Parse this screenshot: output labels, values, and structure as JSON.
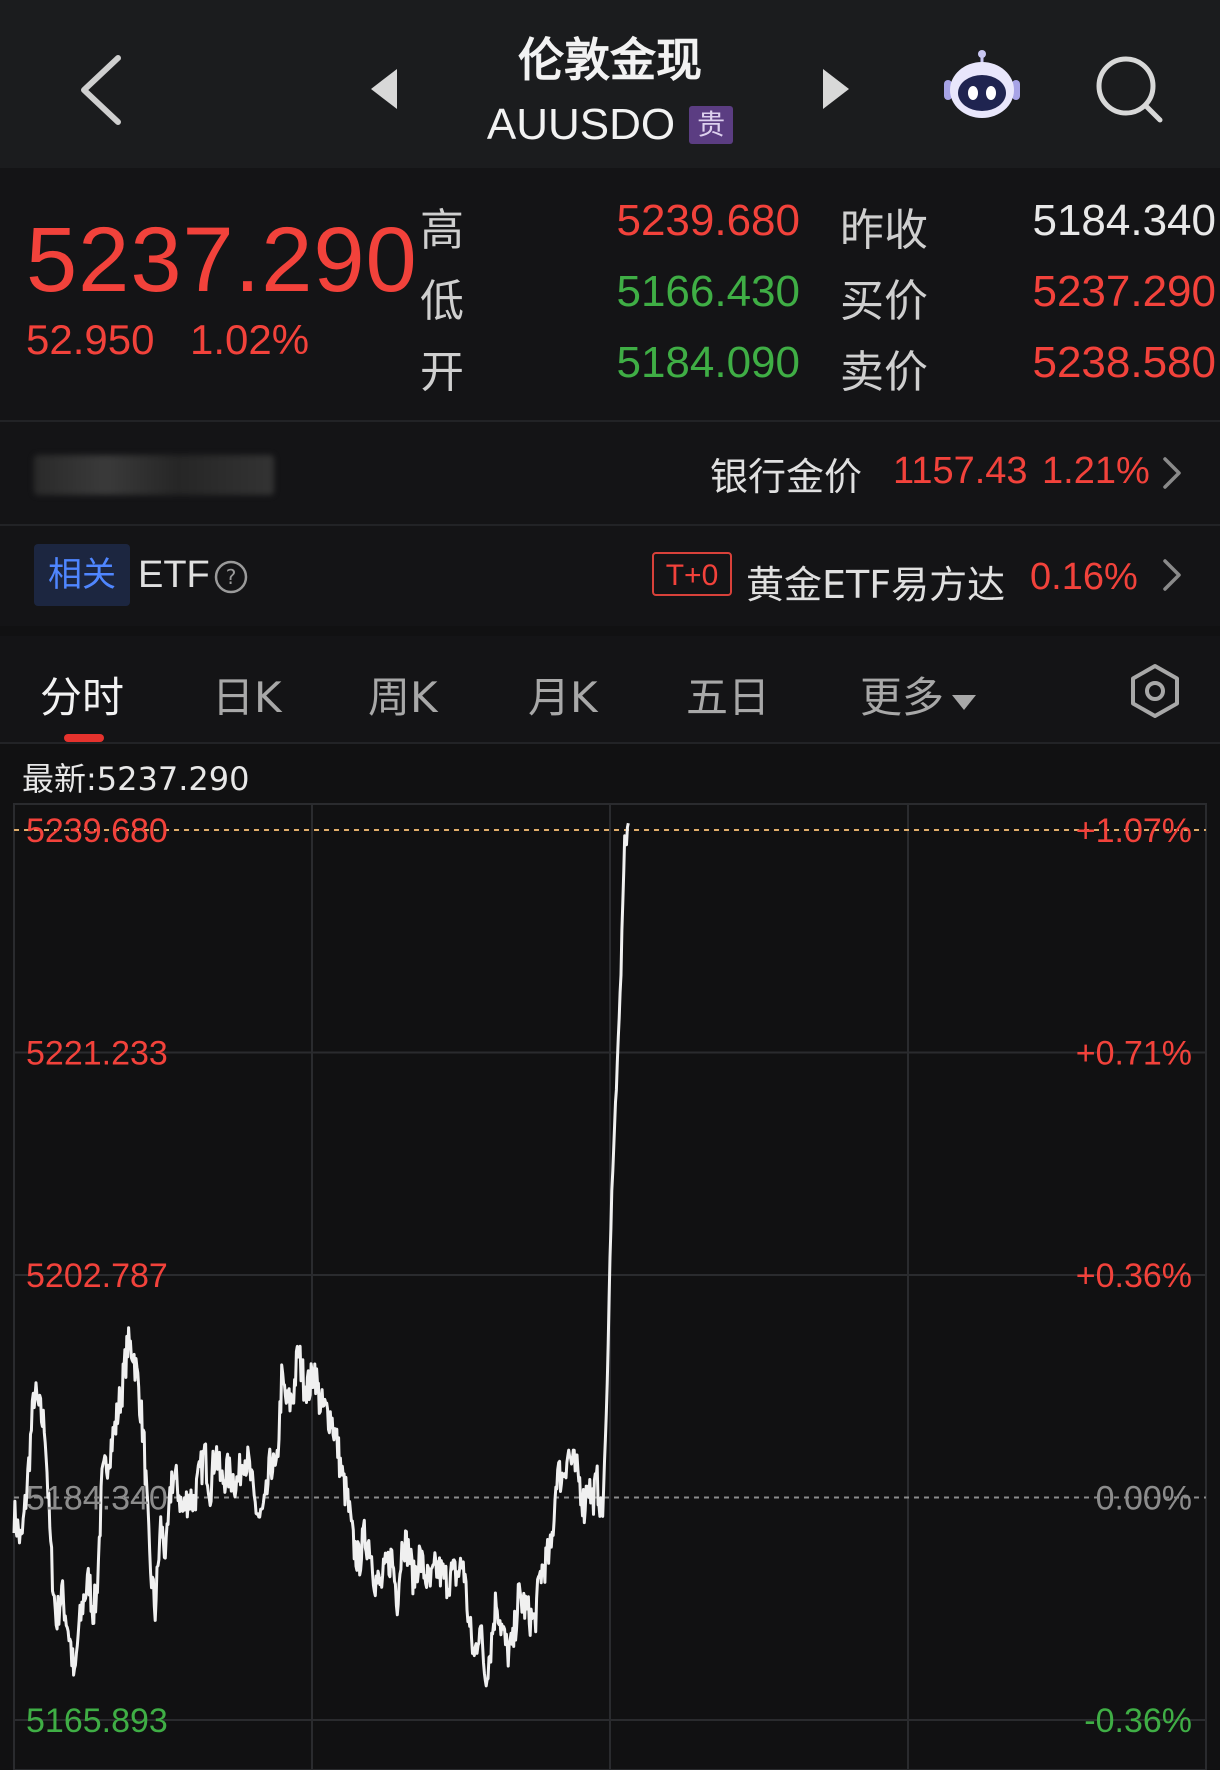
{
  "header": {
    "title": "伦敦金现",
    "symbol": "AUUSDO",
    "tag": "贵",
    "icons": {
      "back": "chevron-left-icon",
      "prev": "triangle-left-icon",
      "next": "triangle-right-icon",
      "assistant": "robot-icon",
      "search": "search-icon"
    }
  },
  "quote": {
    "price": "5237.290",
    "change": "52.950",
    "change_pct": "1.02%",
    "high_label": "高",
    "high": "5239.680",
    "low_label": "低",
    "low": "5166.430",
    "open_label": "开",
    "open": "5184.090",
    "prev_close_label": "昨收",
    "prev_close": "5184.340",
    "bid_label": "买价",
    "bid": "5237.290",
    "ask_label": "卖价",
    "ask": "5238.580",
    "colors": {
      "up": "#f2423b",
      "down": "#3fae45"
    }
  },
  "bank": {
    "label": "银行金价",
    "price": "1157.43",
    "pct": "1.21%"
  },
  "etf": {
    "related": "相关",
    "label": "ETF",
    "t0": "T+0",
    "name": "黄金ETF易方达",
    "pct": "0.16%"
  },
  "tabs": [
    {
      "label": "分时",
      "active": true
    },
    {
      "label": "日K"
    },
    {
      "label": "周K"
    },
    {
      "label": "月K"
    },
    {
      "label": "五日"
    },
    {
      "label": "更多"
    }
  ],
  "chart_data": {
    "type": "line",
    "latest_label": "最新:5237.290",
    "prev_close": 5184.34,
    "y_ticks": [
      "5239.680",
      "5221.233",
      "5202.787",
      "5184.340",
      "5165.893"
    ],
    "pct_ticks": [
      "+1.07%",
      "+0.71%",
      "+0.36%",
      "0.00%",
      "-0.36%"
    ],
    "ylim": [
      5165.893,
      5239.68
    ],
    "x": [
      0,
      2,
      4,
      6,
      8,
      10,
      12,
      14,
      16,
      18,
      20,
      22,
      24,
      26,
      28,
      30,
      32,
      34,
      36,
      38,
      40,
      42,
      44,
      46,
      48,
      50,
      52,
      54,
      56,
      58,
      60,
      62,
      64,
      66,
      68,
      70,
      72,
      74,
      76,
      78,
      80,
      82,
      84,
      86,
      88,
      90,
      92,
      94,
      96,
      98,
      100,
      102,
      104,
      106,
      108,
      110,
      112,
      114,
      116,
      118,
      120,
      122,
      124,
      126,
      128,
      130,
      132,
      134,
      136,
      138,
      140,
      142,
      144,
      146,
      148,
      150,
      152,
      154,
      156,
      158,
      160,
      162,
      164,
      166,
      168,
      170,
      172,
      174,
      176,
      178,
      180,
      182,
      184,
      186,
      188,
      190,
      192,
      194,
      196,
      198,
      200,
      202,
      204,
      206,
      208,
      210,
      212,
      214,
      216,
      218,
      220,
      222,
      224,
      226,
      228,
      230,
      232,
      234,
      236,
      238,
      240,
      242,
      244,
      246,
      248,
      250,
      252,
      254,
      256,
      258,
      260,
      262,
      264,
      266,
      268,
      270,
      272,
      274,
      276,
      278,
      280,
      282,
      284,
      286,
      288,
      290,
      292,
      294,
      296,
      298,
      300,
      302,
      304,
      306,
      308,
      310,
      312,
      314,
      316,
      318,
      320,
      322,
      324,
      326,
      328,
      330,
      332,
      334,
      336,
      338,
      340,
      342,
      344,
      346,
      348,
      350,
      352,
      354,
      356,
      358,
      360,
      362,
      364,
      366,
      368,
      370,
      372,
      374,
      376,
      378,
      380,
      382,
      384,
      386,
      388,
      390,
      392,
      394,
      396,
      398,
      400,
      402,
      404,
      406,
      408,
      410,
      412,
      414,
      416,
      418,
      420,
      422,
      424,
      426,
      428,
      430,
      432,
      434,
      436,
      438,
      440,
      442,
      444,
      446,
      448,
      450,
      452,
      454,
      456,
      458,
      460,
      462,
      464,
      466,
      468,
      470,
      472,
      474,
      476,
      478,
      480,
      482,
      484,
      486,
      488,
      490,
      492,
      494,
      496,
      498,
      500,
      502,
      504,
      506,
      508,
      510,
      512,
      514,
      516,
      518,
      520,
      522,
      524,
      526,
      528,
      530,
      532,
      534,
      536,
      538,
      540,
      542,
      544,
      546,
      548,
      550,
      552,
      554,
      556,
      558,
      560,
      562,
      564,
      566,
      568,
      570,
      572,
      574,
      576,
      578,
      580,
      582,
      584,
      586,
      588,
      590,
      592,
      594,
      596,
      598,
      600,
      602,
      604,
      606,
      608,
      610,
      612,
      614,
      616,
      618,
      620,
      622,
      624,
      626,
      628,
      630,
      632,
      634,
      636,
      638,
      640,
      642,
      644,
      646,
      648,
      650,
      652,
      654,
      656,
      658,
      660,
      662,
      664,
      666,
      668,
      670,
      672,
      674,
      676,
      678,
      680,
      682,
      684,
      686,
      688,
      690,
      692,
      694,
      696,
      698,
      700,
      702,
      704,
      706,
      708,
      710,
      712,
      714,
      716,
      718,
      720,
      722,
      724,
      726,
      728,
      730,
      732,
      734,
      736,
      738,
      740,
      742,
      744,
      746,
      748,
      750,
      752,
      754,
      756,
      758,
      760,
      762,
      764,
      766,
      768,
      770,
      772,
      774,
      776,
      778,
      780,
      782,
      784,
      786,
      788,
      790,
      792,
      794,
      796,
      798,
      800,
      802,
      804,
      806,
      808,
      810,
      812,
      814,
      816,
      818,
      820,
      822,
      824,
      826,
      828,
      830,
      832,
      834,
      836,
      838,
      840,
      842,
      844,
      846,
      848,
      850,
      852,
      854,
      856,
      858,
      860,
      862,
      864,
      866,
      868,
      870,
      872,
      874,
      876,
      878,
      880,
      882,
      884,
      886,
      888,
      890,
      892,
      894,
      896,
      898,
      900,
      902,
      904,
      906,
      908,
      910,
      912,
      914,
      916,
      918,
      920,
      922,
      924,
      926,
      928,
      930,
      932,
      934,
      936,
      938,
      940,
      942,
      944,
      946,
      948,
      950,
      952,
      954,
      956,
      958,
      960,
      962,
      964,
      966,
      968,
      970,
      972,
      974,
      976,
      978,
      980,
      982,
      984,
      986,
      988,
      990,
      992,
      994,
      996,
      998,
      1000,
      1002,
      1004,
      1006,
      1008,
      1010,
      1012,
      1014,
      1016,
      1018,
      1020,
      1022,
      1024,
      1026,
      1028,
      1030,
      1032,
      1034,
      1036,
      1038,
      1040,
      1042,
      1044,
      1046,
      1048,
      1050,
      1052,
      1054,
      1056,
      1058,
      1060,
      1062,
      1064,
      1066,
      1068,
      1070,
      1072,
      1074,
      1076,
      1078,
      1080,
      1082,
      1084,
      1086,
      1088,
      1090,
      1092,
      1094,
      1096,
      1098,
      1100,
      1102,
      1104,
      1106,
      1108,
      1110,
      1112,
      1114,
      1116,
      1118,
      1120,
      1122,
      1124,
      1126,
      1128,
      1130,
      1132,
      1134,
      1136,
      1138,
      1140,
      1142,
      1144,
      1146,
      1148,
      1150,
      1152,
      1154,
      1156,
      1158,
      1160,
      1162,
      1164,
      1166,
      1168,
      1170,
      1172,
      1174,
      1176,
      1178,
      1180,
      1182,
      1184,
      1186,
      1188,
      1190,
      1192,
      1194,
      1196,
      1198,
      1200,
      1202,
      1204,
      1206,
      1208,
      1210,
      1212,
      1214,
      1216,
      1218,
      1220,
      1222,
      1224,
      1226,
      1228,
      1230,
      1232,
      1234,
      1236,
      1238,
      1240,
      1242,
      1244,
      1246,
      1248,
      1250,
      1252,
      1254,
      1256,
      1258,
      1260,
      1262,
      1264,
      1266,
      1268,
      1270,
      1272,
      1274,
      1276,
      1278,
      1280,
      1282,
      1284,
      1286,
      1288,
      1290,
      1292,
      1294,
      1296,
      1298,
      1300
    ],
    "anchors": [
      [
        0,
        5183.0
      ],
      [
        8,
        5180.5
      ],
      [
        14,
        5185.0
      ],
      [
        22,
        5193.0
      ],
      [
        28,
        5191.5
      ],
      [
        34,
        5190.0
      ],
      [
        40,
        5180.0
      ],
      [
        46,
        5174.0
      ],
      [
        52,
        5176.5
      ],
      [
        58,
        5174.0
      ],
      [
        62,
        5172.0
      ],
      [
        66,
        5169.0
      ],
      [
        70,
        5173.0
      ],
      [
        76,
        5176.0
      ],
      [
        82,
        5177.5
      ],
      [
        86,
        5175.0
      ],
      [
        90,
        5176.0
      ],
      [
        96,
        5185.5
      ],
      [
        102,
        5187.5
      ],
      [
        110,
        5190.0
      ],
      [
        118,
        5193.5
      ],
      [
        124,
        5197.0
      ],
      [
        130,
        5196.5
      ],
      [
        136,
        5193.5
      ],
      [
        142,
        5188.5
      ],
      [
        148,
        5179.0
      ],
      [
        154,
        5175.0
      ],
      [
        160,
        5182.0
      ],
      [
        166,
        5179.5
      ],
      [
        172,
        5186.0
      ],
      [
        178,
        5185.5
      ],
      [
        184,
        5183.0
      ],
      [
        190,
        5184.5
      ],
      [
        196,
        5184.0
      ],
      [
        202,
        5186.0
      ],
      [
        208,
        5188.0
      ],
      [
        214,
        5185.0
      ],
      [
        220,
        5188.5
      ],
      [
        226,
        5185.5
      ],
      [
        232,
        5186.5
      ],
      [
        238,
        5186.0
      ],
      [
        244,
        5185.5
      ],
      [
        250,
        5188.0
      ],
      [
        256,
        5187.0
      ],
      [
        262,
        5184.0
      ],
      [
        268,
        5182.5
      ],
      [
        274,
        5183.5
      ],
      [
        280,
        5187.5
      ],
      [
        286,
        5186.0
      ],
      [
        292,
        5194.0
      ],
      [
        298,
        5192.0
      ],
      [
        304,
        5192.5
      ],
      [
        310,
        5196.5
      ],
      [
        316,
        5194.0
      ],
      [
        322,
        5193.5
      ],
      [
        328,
        5195.0
      ],
      [
        334,
        5192.0
      ],
      [
        340,
        5191.5
      ],
      [
        346,
        5191.0
      ],
      [
        352,
        5189.0
      ],
      [
        358,
        5186.0
      ],
      [
        364,
        5184.0
      ],
      [
        370,
        5180.5
      ],
      [
        376,
        5179.0
      ],
      [
        382,
        5181.0
      ],
      [
        388,
        5180.5
      ],
      [
        394,
        5177.5
      ],
      [
        400,
        5177.0
      ],
      [
        406,
        5178.5
      ],
      [
        412,
        5179.5
      ],
      [
        418,
        5176.0
      ],
      [
        424,
        5181.0
      ],
      [
        430,
        5180.0
      ],
      [
        436,
        5177.5
      ],
      [
        442,
        5179.5
      ],
      [
        448,
        5178.0
      ],
      [
        454,
        5177.0
      ],
      [
        460,
        5178.5
      ],
      [
        466,
        5178.0
      ],
      [
        472,
        5177.5
      ],
      [
        478,
        5178.0
      ],
      [
        484,
        5178.0
      ],
      [
        490,
        5179.0
      ],
      [
        496,
        5174.0
      ],
      [
        502,
        5171.0
      ],
      [
        508,
        5174.0
      ],
      [
        514,
        5169.5
      ],
      [
        520,
        5172.0
      ],
      [
        526,
        5176.0
      ],
      [
        532,
        5173.5
      ],
      [
        538,
        5171.5
      ],
      [
        544,
        5172.0
      ],
      [
        550,
        5176.0
      ],
      [
        556,
        5175.5
      ],
      [
        562,
        5174.5
      ],
      [
        568,
        5174.0
      ],
      [
        574,
        5178.0
      ],
      [
        580,
        5179.0
      ],
      [
        586,
        5180.0
      ],
      [
        592,
        5186.5
      ],
      [
        598,
        5186.0
      ],
      [
        604,
        5188.0
      ],
      [
        610,
        5187.0
      ],
      [
        616,
        5186.0
      ],
      [
        622,
        5183.5
      ],
      [
        626,
        5186.0
      ],
      [
        630,
        5184.0
      ],
      [
        636,
        5185.5
      ],
      [
        642,
        5183.0
      ],
      [
        646,
        5191.0
      ],
      [
        650,
        5204.0
      ],
      [
        652,
        5210.0
      ],
      [
        654,
        5213.0
      ],
      [
        656,
        5217.0
      ],
      [
        658,
        5220.0
      ],
      [
        660,
        5224.0
      ],
      [
        662,
        5228.0
      ],
      [
        664,
        5234.0
      ],
      [
        666,
        5239.0
      ],
      [
        668,
        5238.5
      ],
      [
        670,
        5240.3
      ]
    ]
  }
}
